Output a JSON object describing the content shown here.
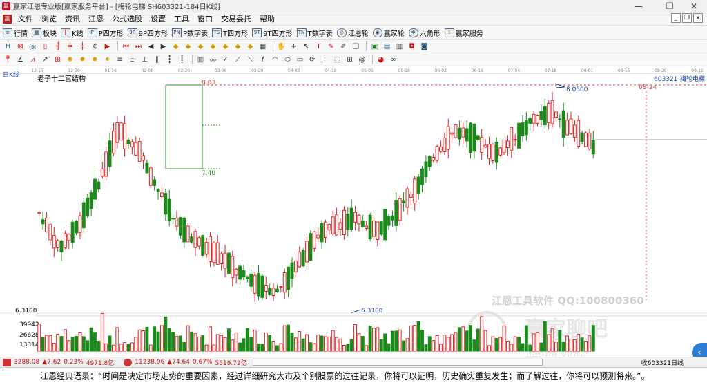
{
  "window": {
    "title": "赢家江恩专业版[赢家服务平台] - [梅轮电梯  SH603321-184日K线]",
    "minimize": "—",
    "restore": "❐",
    "close": "✕"
  },
  "menubar": {
    "items": [
      "文件",
      "浏览",
      "资讯",
      "江恩",
      "公式选股",
      "设置",
      "工具",
      "窗口",
      "交易委托",
      "帮助"
    ],
    "mdi": [
      "_",
      "❐",
      "x"
    ]
  },
  "toolbar1": {
    "items": [
      {
        "icon": "list-icon",
        "label": "行情"
      },
      {
        "icon": "blocks-icon",
        "label": "板块"
      },
      {
        "icon": "kline-icon",
        "label": "K线"
      },
      {
        "icon": "p-square-icon",
        "label": "P四方形"
      },
      {
        "icon": "9p-square-icon",
        "label": "9P四方形"
      },
      {
        "icon": "p-number-table-icon",
        "label": "P数字表"
      },
      {
        "icon": "t-square-icon",
        "label": "T四方形"
      },
      {
        "icon": "9t-square-icon",
        "label": "9T四方形"
      },
      {
        "icon": "t-number-table-icon",
        "label": "T数字表"
      },
      {
        "icon": "gann-icon",
        "label": "江恩轮"
      },
      {
        "icon": "winner-wheel-icon",
        "label": "赢家轮"
      },
      {
        "icon": "hexagon-icon",
        "label": "六角形"
      },
      {
        "icon": "service-icon",
        "label": "赢家服务"
      }
    ]
  },
  "chart": {
    "period_label": "日K线",
    "indicator_title": "老子十二宫结构",
    "stock_code": "603321",
    "stock_name": "梅轮电梯",
    "high_label": "8.03",
    "box_low_label": "7.40",
    "recent_high_label": "8.0500",
    "low_label": "6.3100",
    "low_left_label": "6.3100",
    "marker_top": "08-24",
    "watermark_line": "江恩工具软件   QQ:100800360",
    "watermark_big": "赢家聊吧",
    "watermark_url": "jiaoba.ying...",
    "vol_axis": [
      "39942",
      "26628",
      "13314"
    ],
    "dates": [
      "12-15",
      "12-30",
      "01-16",
      "02-06",
      "02-20",
      "03-06",
      "03-20",
      "04-03",
      "04-18",
      "05-05",
      "05-18",
      "06-02",
      "06-16",
      "07-04",
      "07-18",
      "08-01",
      "08-15",
      "08-29",
      "09-12"
    ]
  },
  "chart_data": {
    "type": "candlestick",
    "title": "老子十二宫结构",
    "series": [
      {
        "name": "梅轮电梯 603321",
        "values": "ohlc"
      }
    ],
    "x": [
      "12-15",
      "12-30",
      "01-16",
      "02-06",
      "02-20",
      "03-06",
      "03-20",
      "04-03",
      "04-18",
      "05-05",
      "05-18",
      "06-02",
      "06-16",
      "07-04",
      "07-18",
      "08-01"
    ],
    "close": [
      7.05,
      6.75,
      6.95,
      7.3,
      7.75,
      7.6,
      7.25,
      6.95,
      6.8,
      6.7,
      6.55,
      6.45,
      6.38,
      6.6,
      6.85,
      6.95,
      7.0,
      6.9,
      7.05,
      7.25,
      7.55,
      7.75,
      7.7,
      7.55,
      7.68,
      7.85,
      7.9,
      7.75,
      7.62
    ],
    "ylim": [
      6.2,
      8.15
    ],
    "annotations": [
      "8.03",
      "7.40",
      "8.0500",
      "6.3100"
    ]
  },
  "status": {
    "sh_index": "3288.08",
    "sh_change": "▲7.62",
    "sh_pct": "0.23%",
    "sh_amount": "4971.8亿",
    "sz_index": "11238.06",
    "sz_change": "▲74.64",
    "sz_pct": "0.67%",
    "sz_amount": "5519.72亿",
    "right_text": "收603321日线"
  },
  "quote": {
    "text": "江恩经典语录：“时间是决定市场走势的重要因素，经过详细研究大市及个别股票的过往记录，你将可以证明，历史确实重复发生；而了解过往，你将可以预测将来。”。"
  },
  "colors": {
    "up": "#e02020",
    "down": "#1a8a1a",
    "accent": "#2b7cd3",
    "level_line": "#e03030",
    "box": "#1a9a1a"
  }
}
